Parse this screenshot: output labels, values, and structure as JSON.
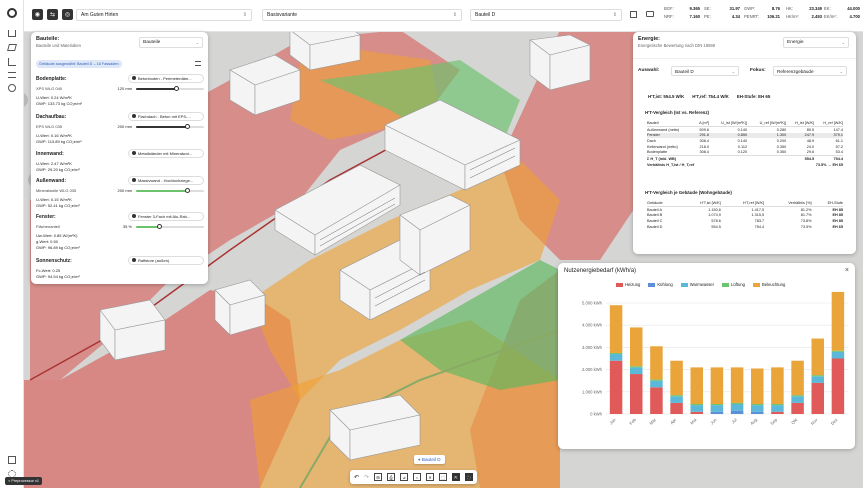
{
  "topbar": {
    "project": "Am Guten Hirten",
    "variant": "Basisvariante",
    "component": "Bauteil D",
    "kpis": [
      {
        "label": "BGF:",
        "value": "9.365"
      },
      {
        "label": "NRF:",
        "value": "7.160"
      },
      {
        "label": "SE:",
        "value": "31.97"
      },
      {
        "label": "PE:",
        "value": "4.34"
      },
      {
        "label": "GWP:",
        "value": "8.76"
      },
      {
        "label": "PENRT:",
        "value": "106.21"
      },
      {
        "label": "HK:",
        "value": "23.349"
      },
      {
        "label": "HK/m²:",
        "value": "2.493"
      },
      {
        "label": "EK:",
        "value": "44.000"
      },
      {
        "label": "EK/m²:",
        "value": "4.700"
      }
    ]
  },
  "left_panel": {
    "title": "Bauteile:",
    "subtitle": "Bauteile und Materialien",
    "select": "Bauteile",
    "badge": "Gebäude ausgewählt: Bauteil D – 16 Fassaden",
    "sections": [
      {
        "title": "Bodenplatte:",
        "component": "Betonboden - Perimeterdäm...",
        "material": "XPS WLG 040",
        "thickness": "120 mm",
        "slider": 0.6,
        "u": "U-Wert:  0.24 W/m²K",
        "g": "GWP:  133.73 kg CO₂e/m²"
      },
      {
        "title": "Dachaufbau:",
        "component": "Flachdach - Beton mit EPS-...",
        "material": "EPS WLG 035",
        "thickness": "200 mm",
        "slider": 0.75,
        "u": "U-Wert:  0.16 W/m²K",
        "g": "GWP:  113.89 kg CO₂e/m²"
      },
      {
        "title": "Innenwand:",
        "component": "Metallständer mit Mineralwol...",
        "u": "U-Wert:  2.47 W/m²K",
        "g": "GWP:  29.20 kg CO₂e/m²"
      },
      {
        "title": "Außenwand:",
        "component": "Massivwand - Hochlochziege...",
        "material": "Mineralwolle WLG 035",
        "thickness": "200 mm",
        "slider": 0.75,
        "u": "U-Wert:  0.15 W/m²K",
        "g": "GWP:  52.41 kg CO₂e/m²"
      },
      {
        "title": "Fenster:",
        "component": "Fenster 3-Fach mit Alu-Rah...",
        "material": "Flächenanteil",
        "thickness": "35 %",
        "slider": 0.35,
        "u": "Uw-Wert:  0.85 W/(m²K)",
        "u2": "g-Wert:  0.50",
        "g": "GWP:  96.89 kg CO₂e/m²"
      },
      {
        "title": "Sonnenschutz:",
        "component": "Raffstore (außen)",
        "u": "Fc-Wert:  0.25",
        "g": "GWP:  94.54 kg CO₂e/m²"
      }
    ]
  },
  "right_panel": {
    "title": "Energie:",
    "subtitle": "Energetische Bewertung nach DIN 18599",
    "select": "Energie",
    "auswahl_label": "Auswahl:",
    "auswahl_value": "Bauteil D",
    "fokus_label": "Fokus:",
    "fokus_value": "Referenzgebäude",
    "summary": {
      "a": "H'T,ist: 554.5 W/K",
      "b": "H'T,ref: 754.4 W/K",
      "c": "EH-Stufe: EH 65"
    },
    "table1_title": "H'T-Vergleich (Ist vs. Referenz)",
    "table1_head": [
      "Bauteil",
      "A [m²]",
      "U_ist [W/(m²K)]",
      "U_ref [W/(m²K)]",
      "H_ist [W/K]",
      "H_ref [W/K]"
    ],
    "table1_rows": [
      [
        "Außenwand (netto)",
        "509.6",
        "0.140",
        "0.280",
        "89.5",
        "147.4"
      ],
      [
        "Fenster",
        "291.6",
        "0.850",
        "1.300",
        "247.9",
        "379.1"
      ],
      [
        "Dach",
        "308.4",
        "0.140",
        "0.200",
        "48.9",
        "61.1"
      ],
      [
        "Kellerwand (netto)",
        "218.0",
        "0.112",
        "0.350",
        "24.0",
        "57.2"
      ],
      [
        "Bodenplatte",
        "308.4",
        "0.120",
        "0.350",
        "29.6",
        "53.4"
      ]
    ],
    "table1_sum": [
      "Σ H_T (inkl. WB)",
      "",
      "",
      "",
      "554.5",
      "754.4"
    ],
    "table1_ratio": [
      "Verhältnis H_T,ist / H_T,ref",
      "73.5% → EH 65"
    ],
    "table2_title": "H'T-Vergleich je Gebäude (Wohngebäude)",
    "table2_head": [
      "Gebäude",
      "H'T,ist [W/K]",
      "H'T,ref [W/K]",
      "Verhältnis [%]",
      "EH-Stufe"
    ],
    "table2_rows": [
      [
        "Bauteil A",
        "1.150,6",
        "1.417,5",
        "81.2%",
        "EH 85"
      ],
      [
        "Bauteil B",
        "1.074,9",
        "1.315,5",
        "81.7%",
        "EH 85"
      ],
      [
        "Bauteil C",
        "578.6",
        "783.7",
        "73.8%",
        "EH 85"
      ],
      [
        "Bauteil D",
        "554.5",
        "754.4",
        "73.5%",
        "EH 65"
      ]
    ]
  },
  "map_labels": {
    "tooltip": "Bauteil D",
    "preprocessor": "Preprocessor v1"
  },
  "chart_panel": {
    "title": "Nutzenergiebedarf (kWh/a)",
    "close": "×"
  },
  "chart_data": {
    "type": "bar",
    "stacked": true,
    "title": "Nutzenergiebedarf (kWh/a)",
    "categories": [
      "Jan",
      "Feb",
      "Mär",
      "Apr",
      "Mai",
      "Jun",
      "Jul",
      "Aug",
      "Sep",
      "Okt",
      "Nov",
      "Dez"
    ],
    "ylim": [
      0,
      5000
    ],
    "yticks": [
      "0 kWh",
      "1.000 kWh",
      "2.000 kWh",
      "3.000 kWh",
      "4.000 kWh",
      "5.000 kWh"
    ],
    "series": [
      {
        "name": "Heizung",
        "color": "#e05a5a",
        "values": [
          2400,
          1800,
          1200,
          500,
          100,
          0,
          0,
          0,
          100,
          500,
          1400,
          2500
        ]
      },
      {
        "name": "Kühlung",
        "color": "#5b8fd8",
        "values": [
          0,
          0,
          0,
          0,
          0,
          100,
          150,
          100,
          0,
          0,
          0,
          0
        ]
      },
      {
        "name": "Warmwasser",
        "color": "#5bb8d8",
        "values": [
          300,
          300,
          300,
          300,
          300,
          300,
          300,
          300,
          300,
          300,
          300,
          300
        ]
      },
      {
        "name": "Lüftung",
        "color": "#6cc46c",
        "values": [
          50,
          50,
          50,
          50,
          50,
          50,
          50,
          50,
          50,
          50,
          50,
          50
        ]
      },
      {
        "name": "Beleuchtung",
        "color": "#e9a53a",
        "values": [
          2150,
          1750,
          1500,
          1550,
          1650,
          1650,
          1600,
          1600,
          1650,
          1550,
          1650,
          2650
        ]
      }
    ]
  }
}
